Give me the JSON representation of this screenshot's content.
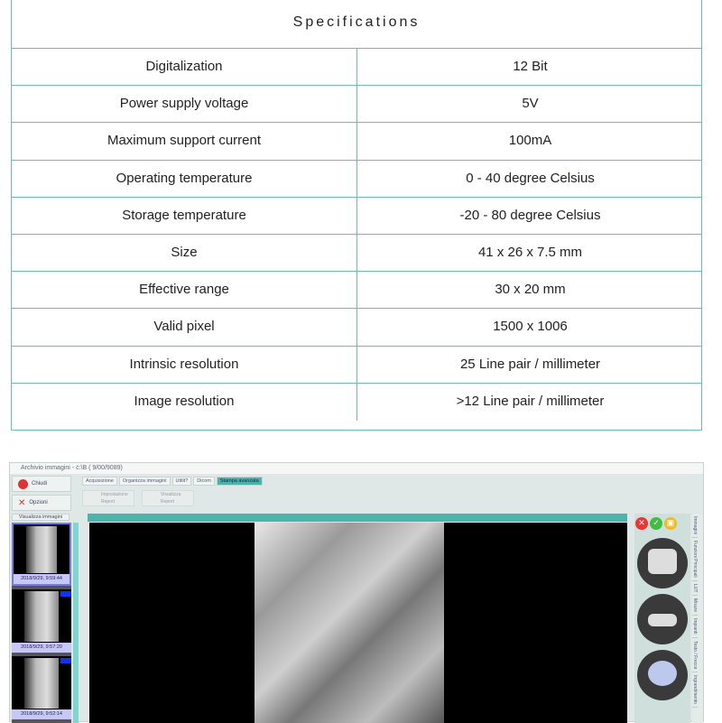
{
  "specs": {
    "title": "Specifications",
    "rows": [
      {
        "label": "Digitalization",
        "value": "12 Bit"
      },
      {
        "label": "Power supply voltage",
        "value": "5V"
      },
      {
        "label": "Maximum support current",
        "value": "100mA"
      },
      {
        "label": "Operating temperature",
        "value": "0 - 40 degree Celsius"
      },
      {
        "label": "Storage temperature",
        "value": "-20 - 80 degree Celsius"
      },
      {
        "label": "Size",
        "value": "41 x 26 x 7.5 mm"
      },
      {
        "label": "Effective range",
        "value": "30 x 20 mm"
      },
      {
        "label": "Valid pixel",
        "value": "1500 x 1006"
      },
      {
        "label": "Intrinsic resolution",
        "value": "25 Line pair / millimeter"
      },
      {
        "label": "Image resolution",
        "value": ">12 Line pair / millimeter"
      }
    ]
  },
  "app": {
    "title": "Archivio immagini - c:\\B ( 9/00/9089)",
    "close": "Chiudi",
    "options": "Opzioni",
    "tabs": [
      "Acquisizione",
      "Organizza immagini",
      "Utilit?",
      "Dicom",
      "Stampa avanzata"
    ],
    "tools": [
      "Impostazione Report",
      "Visualizza Report"
    ],
    "view_images": "Visualizza immagini",
    "thumbs": [
      "2018/9/29, 9:59:44",
      "2018/9/29, 9:57:20",
      "2018/9/29, 9:52:14"
    ],
    "side_tabs": [
      "Immagini",
      "Funzioni Principali",
      "LUT",
      "Misure",
      "Impianti",
      "Testo / Frecce",
      "Ingrandimento"
    ]
  }
}
